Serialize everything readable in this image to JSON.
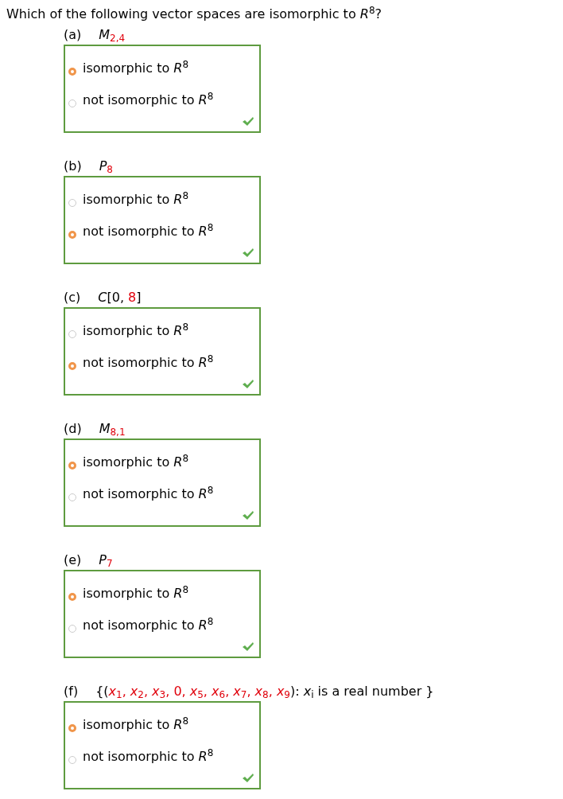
{
  "question": "Which of the following vector spaces are isomorphic to *R*$^{8}$?",
  "parts": [
    {
      "label": "(a)",
      "expression": [
        {
          "text": "*M*",
          "kind": "plain"
        },
        {
          "text": "$_{2,4}$",
          "kind": "given"
        }
      ],
      "correct": true,
      "options": [
        {
          "text": "isomorphic to *R*$^{8}$",
          "selected": true
        },
        {
          "text": "not isomorphic to *R*$^{8}$",
          "selected": false
        }
      ]
    },
    {
      "label": "(b)",
      "expression": [
        {
          "text": "*P*",
          "kind": "plain"
        },
        {
          "text": "$_{8}$",
          "kind": "given"
        }
      ],
      "correct": true,
      "options": [
        {
          "text": "isomorphic to *R*$^{8}$",
          "selected": false
        },
        {
          "text": "not isomorphic to *R*$^{8}$",
          "selected": true
        }
      ]
    },
    {
      "label": "(c)",
      "expression": [
        {
          "text": "*C*[0, ",
          "kind": "plain"
        },
        {
          "text": "8",
          "kind": "given"
        },
        {
          "text": "]",
          "kind": "plain"
        }
      ],
      "correct": true,
      "options": [
        {
          "text": "isomorphic to *R*$^{8}$",
          "selected": false
        },
        {
          "text": "not isomorphic to *R*$^{8}$",
          "selected": true
        }
      ]
    },
    {
      "label": "(d)",
      "expression": [
        {
          "text": "*M*",
          "kind": "plain"
        },
        {
          "text": "$_{8,1}$",
          "kind": "given"
        }
      ],
      "correct": true,
      "options": [
        {
          "text": "isomorphic to *R*$^{8}$",
          "selected": true
        },
        {
          "text": "not isomorphic to *R*$^{8}$",
          "selected": false
        }
      ]
    },
    {
      "label": "(e)",
      "expression": [
        {
          "text": "*P*",
          "kind": "plain"
        },
        {
          "text": "$_{7}$",
          "kind": "given"
        }
      ],
      "correct": true,
      "options": [
        {
          "text": "isomorphic to *R*$^{8}$",
          "selected": true
        },
        {
          "text": "not isomorphic to *R*$^{8}$",
          "selected": false
        }
      ]
    },
    {
      "label": "(f)",
      "expression": [
        {
          "text": "{(",
          "kind": "plain"
        },
        {
          "text": "*x*$_{1}$, *x*$_{2}$, *x*$_{3}$, 0, *x*$_{5}$, *x*$_{6}$, *x*$_{7}$, *x*$_{8}$, *x*$_{9}$",
          "kind": "given"
        },
        {
          "text": "): *x*$_{i}$ is a real number }",
          "kind": "plain"
        }
      ],
      "correct": true,
      "options": [
        {
          "text": "isomorphic to *R*$^{8}$",
          "selected": true
        },
        {
          "text": "not isomorphic to *R*$^{8}$",
          "selected": false
        }
      ]
    }
  ]
}
